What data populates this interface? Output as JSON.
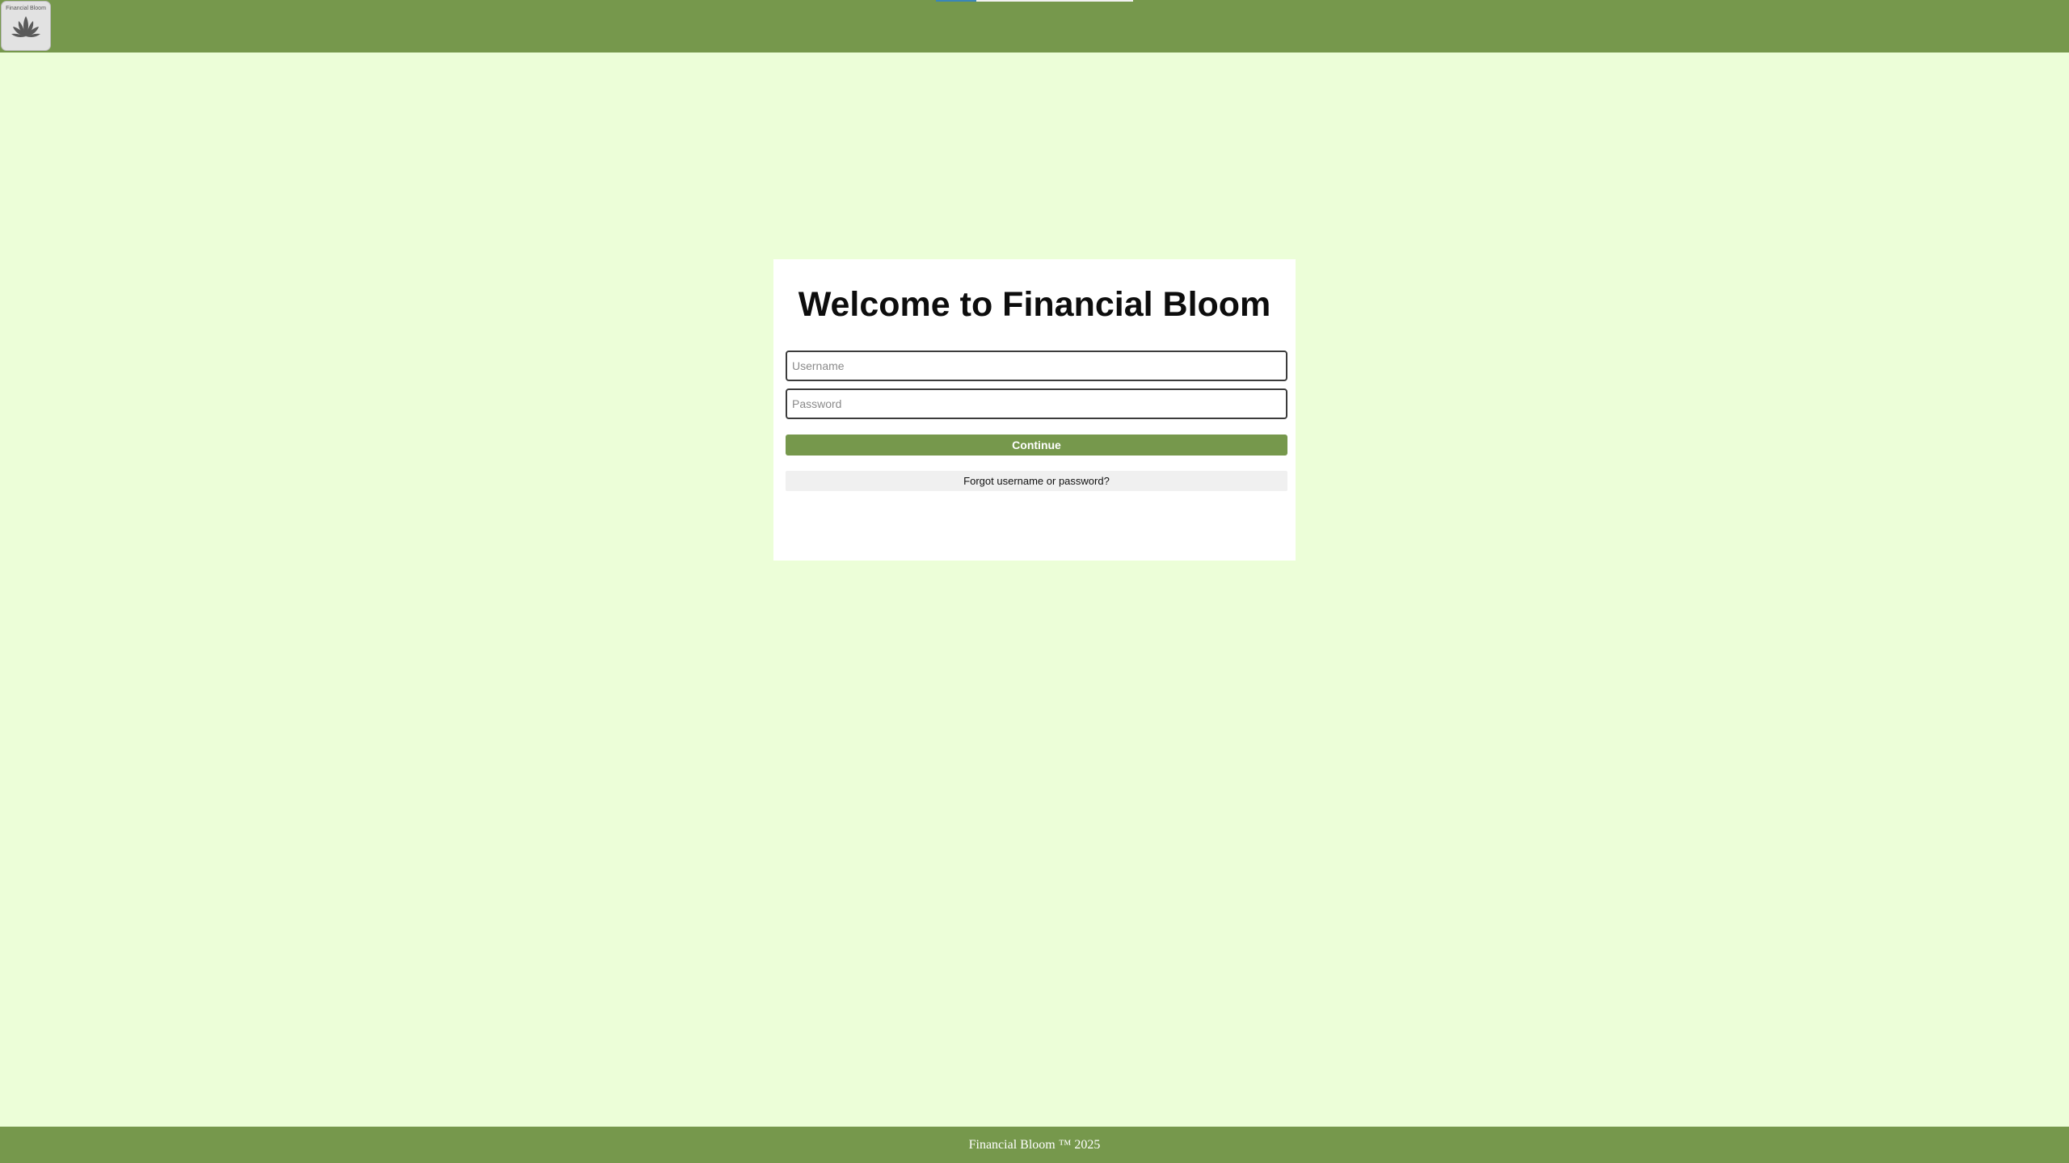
{
  "header": {
    "logo_text": "Financial Bloom",
    "logo_icon": "lotus-icon"
  },
  "login": {
    "title": "Welcome to Financial Bloom",
    "username_placeholder": "Username",
    "password_placeholder": "Password",
    "continue_label": "Continue",
    "forgot_label": "Forgot username or password?"
  },
  "footer": {
    "text": "Financial Bloom ™ 2025"
  },
  "colors": {
    "brand_green": "#76984c",
    "page_background": "#ecfed8",
    "card_background": "#ffffff"
  }
}
